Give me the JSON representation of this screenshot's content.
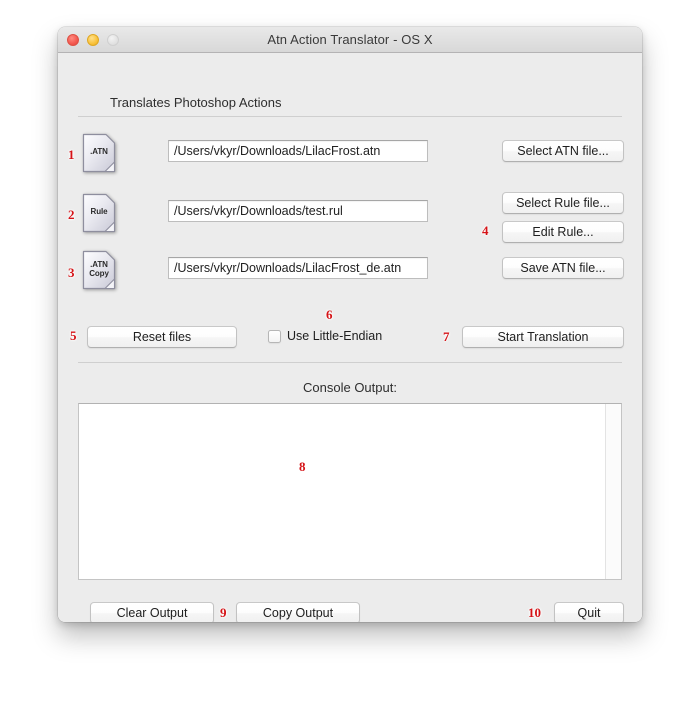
{
  "window": {
    "title": "Atn Action Translator - OS X",
    "subtitle": "Translates Photoshop Actions",
    "traffic": {
      "close": "close-button",
      "minimize": "minimize-button",
      "zoom": "zoom-button"
    }
  },
  "annotations": {
    "a1": "1",
    "a2": "2",
    "a3": "3",
    "a4": "4",
    "a5": "5",
    "a6": "6",
    "a7": "7",
    "a8": "8",
    "a9": "9",
    "a10": "10"
  },
  "rows": {
    "atn": {
      "icon_label_line1": ".ATN",
      "icon_label_line2": "",
      "path": "/Users/vkyr/Downloads/LilacFrost.atn",
      "button": "Select ATN file..."
    },
    "rule": {
      "icon_label_line1": "Rule",
      "icon_label_line2": "",
      "path": "/Users/vkyr/Downloads/test.rul",
      "button": "Select Rule file...",
      "button2": "Edit Rule..."
    },
    "copy": {
      "icon_label_line1": ".ATN",
      "icon_label_line2": "Copy",
      "path": "/Users/vkyr/Downloads/LilacFrost_de.atn",
      "button": "Save ATN file..."
    }
  },
  "controls": {
    "reset": "Reset files",
    "checkbox_label": "Use Little-Endian",
    "checkbox_checked": false,
    "start": "Start Translation"
  },
  "console": {
    "label": "Console Output:",
    "text": ""
  },
  "footer": {
    "clear": "Clear Output",
    "copy": "Copy Output",
    "quit": "Quit"
  },
  "colors": {
    "annotation": "#d51317",
    "window_bg": "#ececec",
    "titlebar_top": "#e9e9e9",
    "titlebar_bottom": "#d8d8d8"
  }
}
